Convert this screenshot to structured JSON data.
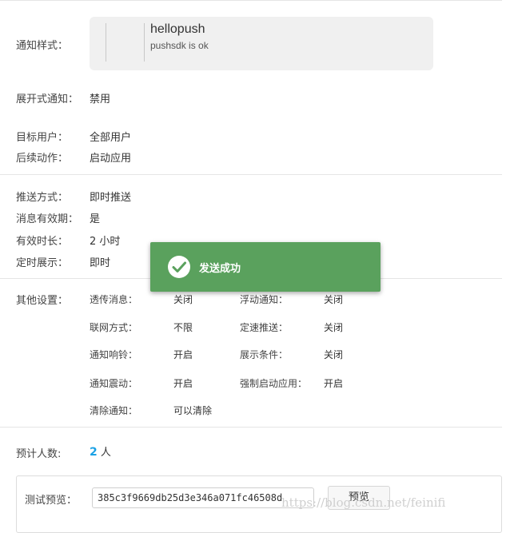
{
  "notification_style": {
    "label": "通知样式：",
    "title": "hellopush",
    "content": "pushsdk is ok"
  },
  "expanded": {
    "label": "展开式通知：",
    "value": "禁用"
  },
  "target": {
    "label": "目标用户：",
    "value": "全部用户"
  },
  "follow_action": {
    "label": "后续动作：",
    "value": "启动应用"
  },
  "push_method": {
    "label": "推送方式：",
    "value": "即时推送"
  },
  "validity": {
    "label": "消息有效期：",
    "value": "是"
  },
  "duration": {
    "label": "有效时长：",
    "value": "2 小时"
  },
  "scheduled": {
    "label": "定时展示：",
    "value": "即时"
  },
  "other_settings": {
    "label": "其他设置：",
    "items": [
      {
        "label": "透传消息：",
        "value": "关闭"
      },
      {
        "label": "浮动通知：",
        "value": "关闭"
      },
      {
        "label": "联网方式：",
        "value": "不限"
      },
      {
        "label": "定速推送：",
        "value": "关闭"
      },
      {
        "label": "通知响铃：",
        "value": "开启"
      },
      {
        "label": "展示条件：",
        "value": "关闭"
      },
      {
        "label": "通知震动：",
        "value": "开启"
      },
      {
        "label": "强制启动应用：",
        "value": "开启"
      },
      {
        "label": "清除通知：",
        "value": "可以清除"
      }
    ]
  },
  "estimate": {
    "label": "预计人数:",
    "count": "2",
    "unit": "人"
  },
  "test_preview": {
    "label": "测试预览：",
    "input_value": "385c3f9669db25d3e346a071fc46508d",
    "button_label": "预览"
  },
  "toast": {
    "message": "发送成功",
    "icon": "check-circle-icon",
    "color": "#5aa15d"
  },
  "watermark": "https://blog.csdn.net/feinifi"
}
